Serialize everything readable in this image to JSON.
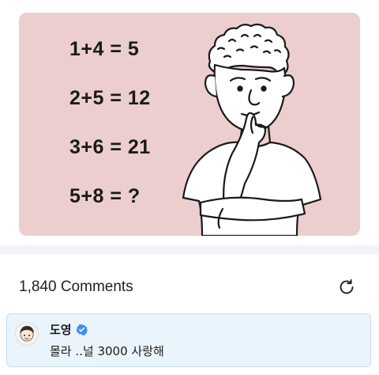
{
  "post": {
    "equations": [
      "1+4 = 5",
      "2+5 = 12",
      "3+6 = 21",
      "5+8 = ?"
    ],
    "image_background": "#eccece"
  },
  "comments": {
    "count_label": "1,840 Comments",
    "refresh_icon": "refresh-icon"
  },
  "pinned_comment": {
    "author": "도영",
    "verified_icon": "verified-badge-icon",
    "text": "몰라 ..널 3000 사랑해",
    "highlight_color": "#eaf4fd"
  }
}
